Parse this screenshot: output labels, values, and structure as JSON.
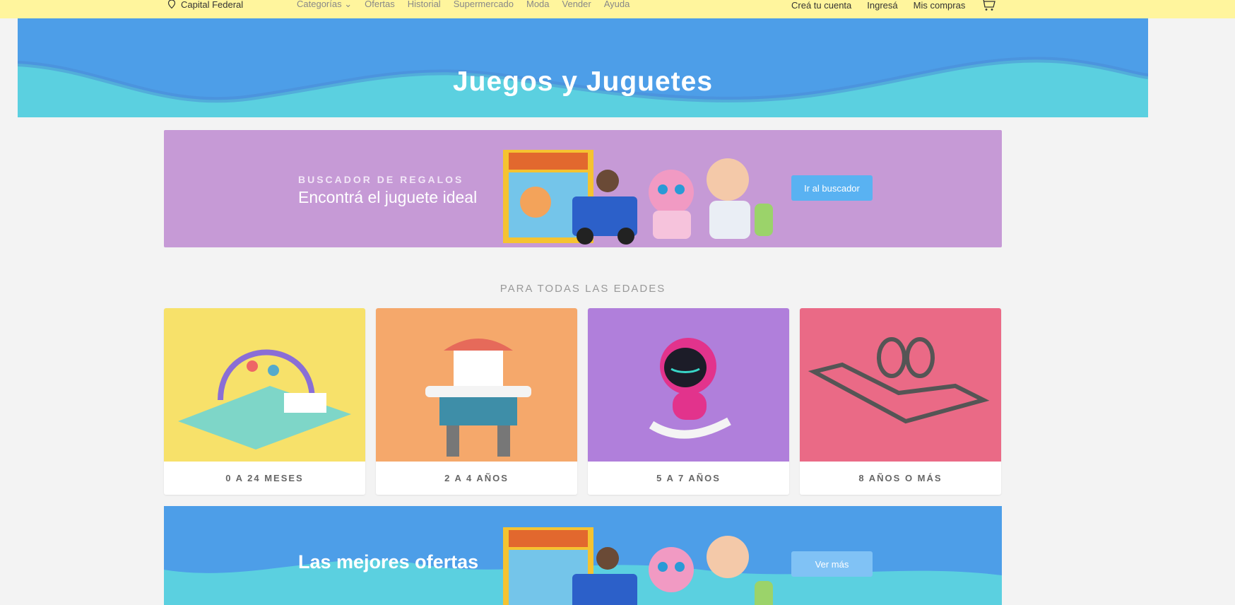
{
  "topbar": {
    "location": "Capital Federal",
    "nav": [
      "Categorías ⌄",
      "Ofertas",
      "Historial",
      "Supermercado",
      "Moda",
      "Vender",
      "Ayuda"
    ],
    "account": [
      "Creá tu cuenta",
      "Ingresá",
      "Mis compras"
    ]
  },
  "hero": {
    "title": "Juegos y Juguetes"
  },
  "promo": {
    "eyebrow": "BUSCADOR DE REGALOS",
    "headline": "Encontrá el juguete ideal",
    "button": "Ir al buscador"
  },
  "ages": {
    "title": "PARA TODAS LAS EDADES",
    "items": [
      {
        "label": "0 A 24 MESES",
        "color": "#f7e16a"
      },
      {
        "label": "2 A 4 AÑOS",
        "color": "#f5a86b"
      },
      {
        "label": "5 A 7 AÑOS",
        "color": "#b07fdb"
      },
      {
        "label": "8 AÑOS O MÁS",
        "color": "#ea6a86"
      }
    ]
  },
  "offers": {
    "headline": "Las mejores ofertas",
    "button": "Ver más"
  }
}
